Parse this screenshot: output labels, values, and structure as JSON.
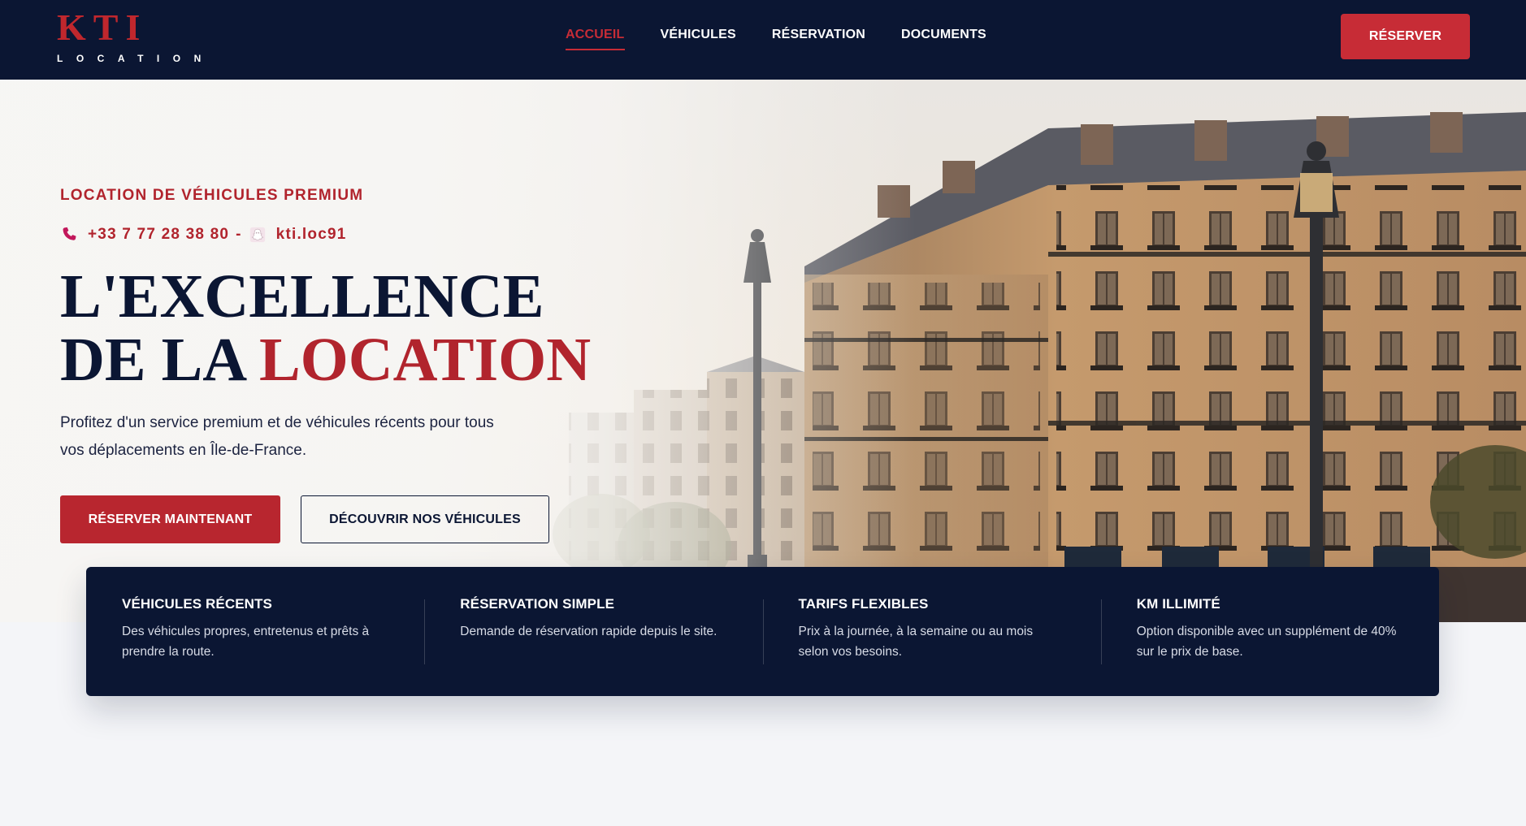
{
  "brand": {
    "name": "KTI",
    "tagline": "LOCATION"
  },
  "nav": {
    "items": [
      {
        "label": "ACCUEIL",
        "active": true
      },
      {
        "label": "VÉHICULES",
        "active": false
      },
      {
        "label": "RÉSERVATION",
        "active": false
      },
      {
        "label": "DOCUMENTS",
        "active": false
      }
    ],
    "cta_label": "RÉSERVER"
  },
  "hero": {
    "eyebrow": "LOCATION DE VÉHICULES PREMIUM",
    "phone": "+33 7 77 28 38 80",
    "separator": "-",
    "snapchat": "kti.loc91",
    "headline_line1": "L'EXCELLENCE",
    "headline_line2_prefix": "DE LA",
    "headline_line2_accent": "LOCATION",
    "lead": "Profitez d'un service premium et de véhicules récents pour tous vos déplacements en Île-de-France.",
    "primary_cta": "RÉSERVER MAINTENANT",
    "secondary_cta": "DÉCOUVRIR NOS VÉHICULES",
    "icons": {
      "phone": "phone-icon",
      "social": "snapchat-icon"
    }
  },
  "features": [
    {
      "title": "VÉHICULES RÉCENTS",
      "text": "Des véhicules propres, entretenus et prêts à prendre la route."
    },
    {
      "title": "RÉSERVATION SIMPLE",
      "text": "Demande de réservation rapide depuis le site."
    },
    {
      "title": "TARIFS FLEXIBLES",
      "text": "Prix à la journée, à la semaine ou au mois selon vos besoins."
    },
    {
      "title": "KM ILLIMITÉ",
      "text": "Option disponible avec un supplément de 40% sur le prix de base."
    }
  ],
  "colors": {
    "navy": "#0b1633",
    "accent_red": "#c72c36",
    "background": "#f4f5f8"
  }
}
